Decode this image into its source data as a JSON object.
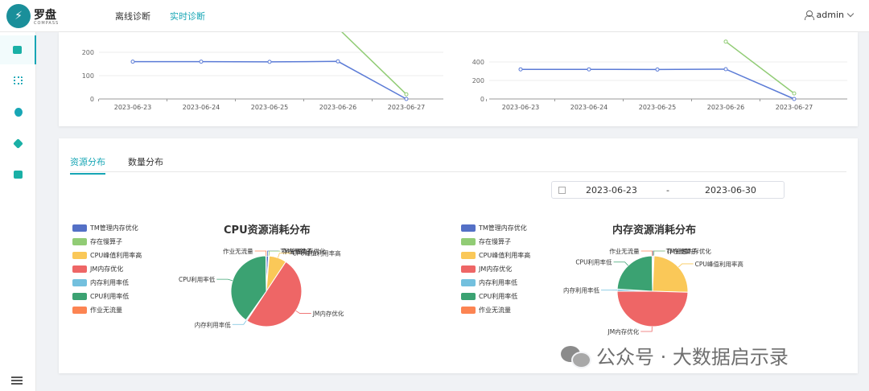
{
  "app": {
    "logo_text": "罗盘",
    "logo_sub": "COMPASS",
    "logo_mark": "⚡"
  },
  "nav": {
    "items": [
      {
        "label": "离线诊断"
      },
      {
        "label": "实时诊断"
      }
    ],
    "active": 1
  },
  "user": {
    "name": "admin"
  },
  "sidebar": {
    "icons": [
      "monitor-icon",
      "grid-icon",
      "hexagon-icon",
      "cube-icon",
      "window-icon"
    ],
    "menu_icon": "hamburger-icon"
  },
  "colors": {
    "accent": "#17a6b5"
  },
  "tabs": {
    "items": [
      "资源分布",
      "数量分布"
    ],
    "active": 0
  },
  "date_range": {
    "start": "2023-06-23",
    "separator": "-",
    "end": "2023-06-30"
  },
  "chart_data": [
    {
      "type": "line",
      "x": [
        "2023-06-23",
        "2023-06-24",
        "2023-06-25",
        "2023-06-26",
        "2023-06-27"
      ],
      "yticks": [
        "0",
        "100",
        "200"
      ],
      "ylim": [
        0,
        200
      ],
      "series": [
        {
          "values": [
            160,
            160,
            159,
            161,
            0
          ],
          "color": "#5b7bd6"
        },
        {
          "values": [
            null,
            null,
            null,
            310,
            20
          ],
          "color": "#91cc75"
        }
      ]
    },
    {
      "type": "line",
      "x": [
        "2023-06-23",
        "2023-06-24",
        "2023-06-25",
        "2023-06-26",
        "2023-06-27"
      ],
      "yticks": [
        "0",
        "200",
        "400"
      ],
      "ylim": [
        0,
        400
      ],
      "series": [
        {
          "values": [
            320,
            320,
            318,
            322,
            0
          ],
          "color": "#5b7bd6"
        },
        {
          "values": [
            null,
            null,
            null,
            620,
            60
          ],
          "color": "#91cc75"
        }
      ]
    },
    {
      "type": "pie",
      "title": "CPU资源消耗分布",
      "slices": [
        {
          "name": "TM管理内存优化",
          "value": 1,
          "color": "#5470c6"
        },
        {
          "name": "存在慢算子",
          "value": 0.3,
          "color": "#91cc75"
        },
        {
          "name": "CPU峰值利用率高",
          "value": 8,
          "color": "#fac858"
        },
        {
          "name": "JM内存优化",
          "value": 50,
          "color": "#ee6666"
        },
        {
          "name": "内存利用率低",
          "value": 0.5,
          "color": "#73c0de"
        },
        {
          "name": "CPU利用率低",
          "value": 40,
          "color": "#3ba272"
        },
        {
          "name": "作业无流量",
          "value": 0.2,
          "color": "#fc8452"
        }
      ]
    },
    {
      "type": "pie",
      "title": "内存资源消耗分布",
      "slices": [
        {
          "name": "TM管理内存优化",
          "value": 0.5,
          "color": "#5470c6"
        },
        {
          "name": "存在慢算子",
          "value": 0.2,
          "color": "#91cc75"
        },
        {
          "name": "CPU峰值利用率高",
          "value": 25,
          "color": "#fac858"
        },
        {
          "name": "JM内存优化",
          "value": 50,
          "color": "#ee6666"
        },
        {
          "name": "内存利用率低",
          "value": 1,
          "color": "#73c0de"
        },
        {
          "name": "CPU利用率低",
          "value": 24,
          "color": "#3ba272"
        },
        {
          "name": "作业无流量",
          "value": 0.2,
          "color": "#fc8452"
        }
      ]
    }
  ],
  "legend_items": [
    {
      "label": "TM管理内存优化",
      "color": "#5470c6"
    },
    {
      "label": "存在慢算子",
      "color": "#91cc75"
    },
    {
      "label": "CPU峰值利用率高",
      "color": "#fac858"
    },
    {
      "label": "JM内存优化",
      "color": "#ee6666"
    },
    {
      "label": "内存利用率低",
      "color": "#73c0de"
    },
    {
      "label": "CPU利用率低",
      "color": "#3ba272"
    },
    {
      "label": "作业无流量",
      "color": "#fc8452"
    }
  ],
  "watermark": {
    "text": "公众号 · 大数据启示录",
    "icon": "wechat-icon"
  }
}
